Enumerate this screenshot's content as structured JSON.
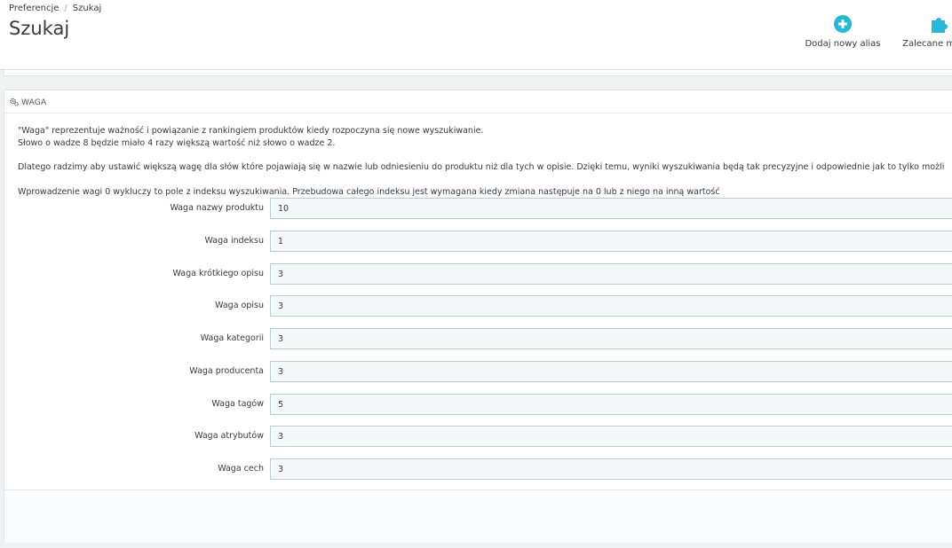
{
  "breadcrumb": {
    "parent": "Preferencje",
    "separator": "/",
    "current": "Szukaj"
  },
  "page_title": "Szukaj",
  "toolbar": {
    "add_alias_label": "Dodaj nowy alias",
    "modules_label": "Zalecane modu",
    "accent_color": "#25b9d7"
  },
  "panel": {
    "heading": "WAGA",
    "description": [
      "\"Waga\" reprezentuje ważność i powiązanie z rankingiem produktów kiedy rozpoczyna się nowe wyszukiwanie.",
      "Słowo o wadze 8 będzie miało 4 razy większą wartość niż słowo o wadze 2.",
      "Dlatego radzimy aby ustawić większą wagę dla słów które pojawiają się w nazwie lub odniesieniu do produktu niż dla tych w opisie. Dzięki temu, wyniki wyszukiwania będą tak precyzyjne i odpowiednie jak to tylko możli",
      "Wprowadzenie wagi 0 wykluczy to pole z indeksu wyszukiwania. Przebudowa całego indeksu jest wymagana kiedy zmiana następuje na 0 lub z niego na inną wartość"
    ],
    "fields": [
      {
        "label": "Waga nazwy produktu",
        "value": "10"
      },
      {
        "label": "Waga indeksu",
        "value": "1"
      },
      {
        "label": "Waga krótkiego opisu",
        "value": "3"
      },
      {
        "label": "Waga opisu",
        "value": "3"
      },
      {
        "label": "Waga kategorii",
        "value": "3"
      },
      {
        "label": "Waga producenta",
        "value": "3"
      },
      {
        "label": "Waga tagów",
        "value": "5"
      },
      {
        "label": "Waga atrybutów",
        "value": "3"
      },
      {
        "label": "Waga cech",
        "value": "3"
      }
    ]
  }
}
